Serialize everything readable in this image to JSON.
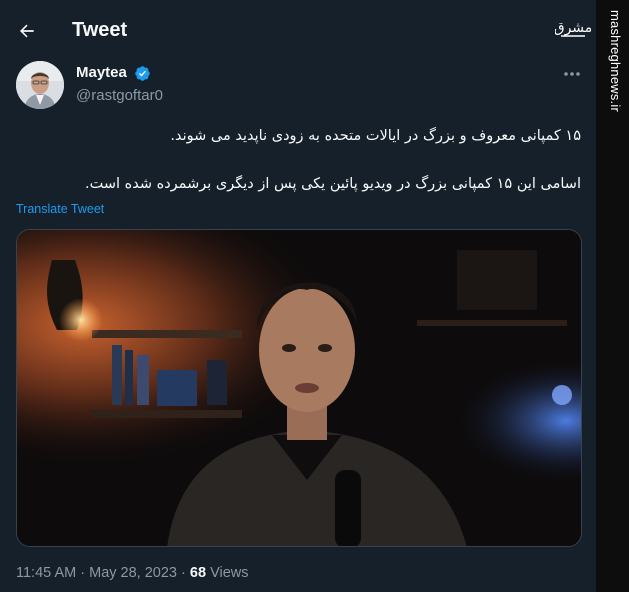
{
  "header": {
    "title": "Tweet"
  },
  "author": {
    "display_name": "Maytea",
    "handle": "@rastgoftar0",
    "verified": true
  },
  "tweet": {
    "lines": [
      "۱۵ کمپانی معروف و بزرگ در ایالات متحده به زودی ناپدید می شوند.",
      "اسامی این ۱۵ کمپانی بزرگ در ویدیو پائین یکی پس از دیگری برشمرده شده است."
    ],
    "translate_label": "Translate Tweet"
  },
  "meta": {
    "time": "11:45 AM",
    "separator": "·",
    "date": "May 28, 2023",
    "views_count": "68",
    "views_label": "Views"
  },
  "watermark": {
    "site": "mashreghnews.ir",
    "logo_text": "مشرق"
  },
  "colors": {
    "background": "#15202b",
    "accent": "#1d9bf0",
    "secondary_text": "#8b98a5",
    "primary_text": "#f7f9f9"
  },
  "icons": [
    "back-arrow-icon",
    "verified-badge-icon",
    "more-options-icon"
  ]
}
